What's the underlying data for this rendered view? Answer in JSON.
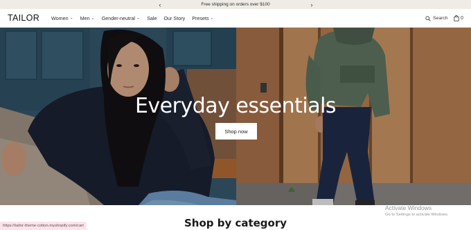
{
  "announcement": {
    "text": "Free shipping on orders over $100",
    "prev_icon": "chevron-left-icon",
    "next_icon": "chevron-right-icon"
  },
  "header": {
    "logo": "TAILOR",
    "nav": [
      {
        "label": "Women",
        "has_dropdown": true
      },
      {
        "label": "Men",
        "has_dropdown": true
      },
      {
        "label": "Gender-neutral",
        "has_dropdown": true
      },
      {
        "label": "Sale",
        "has_dropdown": false
      },
      {
        "label": "Our Story",
        "has_dropdown": false
      },
      {
        "label": "Presets",
        "has_dropdown": true
      }
    ],
    "search_label": "Search",
    "cart_count": "0"
  },
  "hero": {
    "title": "Everyday essentials",
    "button_label": "Shop now"
  },
  "section_title": "Shop by category",
  "status_url": "https://tailor-theme-cotton.myshopify.com/cart",
  "watermark": {
    "line1": "Activate Windows",
    "line2": "Go to Settings to activate Windows."
  },
  "colors": {
    "announcement_bg": "#efece6",
    "hero_left_bg": "#2e4f62",
    "hero_right_bg": "#b07a52",
    "button_bg": "#ffffff"
  }
}
